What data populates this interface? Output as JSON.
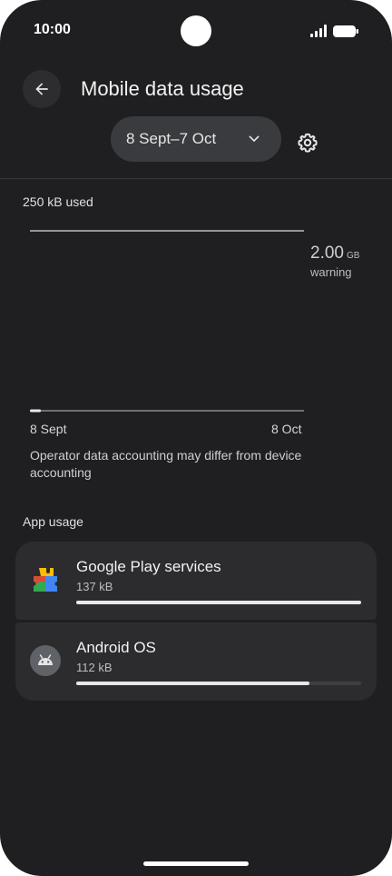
{
  "status_bar": {
    "time": "10:00"
  },
  "header": {
    "title": "Mobile data usage"
  },
  "date_range": {
    "label": "8 Sept–7 Oct"
  },
  "usage": {
    "used_label": "250 kB used",
    "warning_value": "2.00",
    "warning_unit": "GB",
    "warning_label": "warning",
    "x_start": "8 Sept",
    "x_end": "8 Oct",
    "used_fraction": 0.04,
    "note": "Operator data accounting may differ from device accounting"
  },
  "app_usage": {
    "title": "App usage",
    "apps": [
      {
        "name": "Google Play services",
        "size": "137 kB",
        "fraction": 1.0,
        "icon": "google-play-services-icon"
      },
      {
        "name": "Android OS",
        "size": "112 kB",
        "fraction": 0.818,
        "icon": "android-icon"
      }
    ]
  },
  "colors": {
    "background": "#1f1f21",
    "card": "#2c2c2f",
    "pill": "#3a3b3f",
    "bar": "#e8e8e8"
  }
}
